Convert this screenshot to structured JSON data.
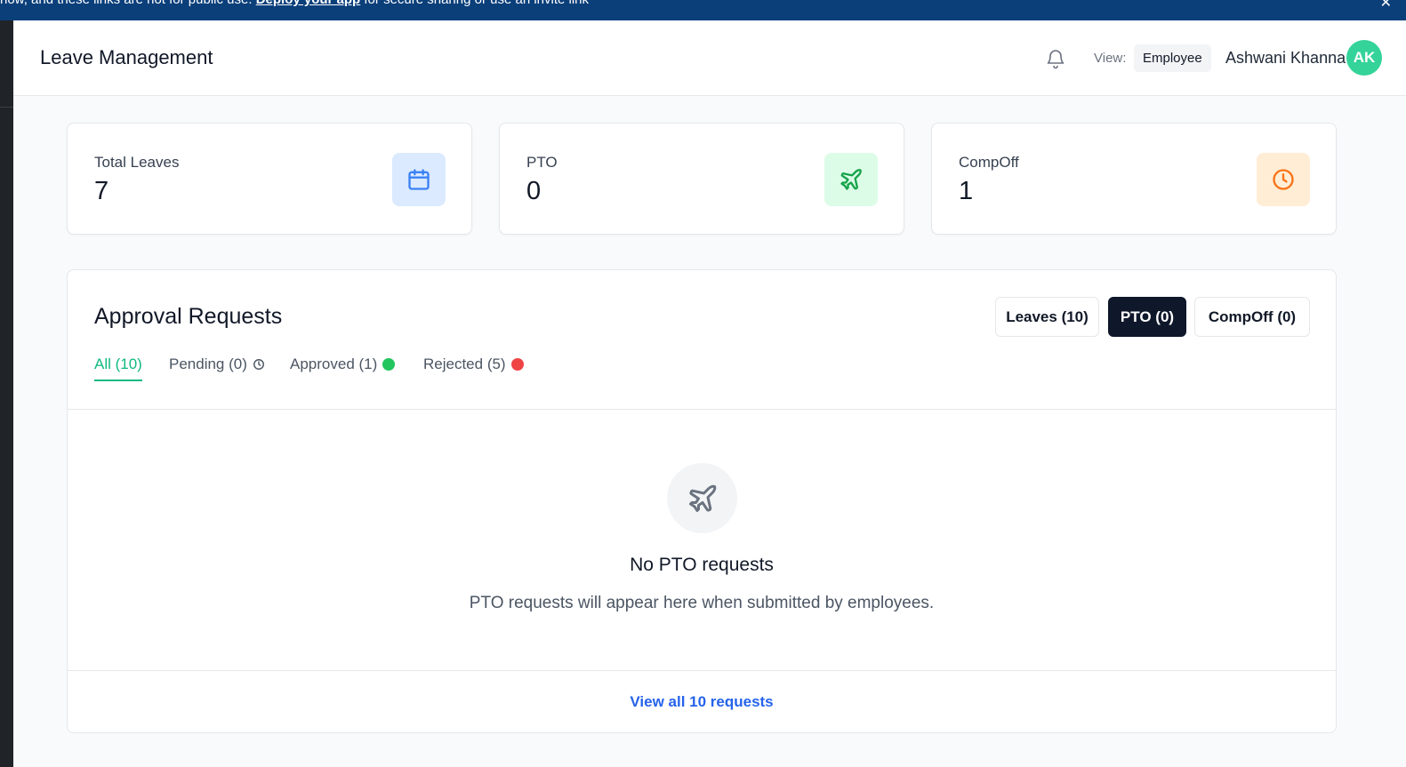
{
  "banner": {
    "text_before": "now, and these links are not for public use.",
    "link_text": "Deploy your app",
    "text_after": "for secure sharing or use an invite link",
    "close_glyph": "✕"
  },
  "header": {
    "title": "Leave Management",
    "view_label": "View:",
    "view_value": "Employee",
    "user_name": "Ashwani Khanna",
    "avatar_initials": "AK"
  },
  "stats": [
    {
      "label": "Total Leaves",
      "value": "7",
      "icon": "calendar-icon",
      "bg": "#dbeafe",
      "color": "#3b82f6"
    },
    {
      "label": "PTO",
      "value": "0",
      "icon": "plane-icon",
      "bg": "#dcfce7",
      "color": "#16a34a"
    },
    {
      "label": "CompOff",
      "value": "1",
      "icon": "clock-icon",
      "bg": "#ffedd5",
      "color": "#f97316"
    }
  ],
  "approvals": {
    "title": "Approval Requests",
    "type_buttons": [
      {
        "label": "Leaves (10)",
        "active": false
      },
      {
        "label": "PTO (0)",
        "active": true
      },
      {
        "label": "CompOff (0)",
        "active": false
      }
    ],
    "filters": [
      {
        "label": "All (10)",
        "active": true
      },
      {
        "label": "Pending (0)",
        "indicator": "clock-icon"
      },
      {
        "label": "Approved (1)",
        "indicator": "green-dot",
        "color": "#22c55e"
      },
      {
        "label": "Rejected (5)",
        "indicator": "red-dot",
        "color": "#ef4444"
      }
    ],
    "empty_title": "No PTO requests",
    "empty_subtitle": "PTO requests will appear here when submitted by employees.",
    "view_all": "View all 10 requests"
  }
}
